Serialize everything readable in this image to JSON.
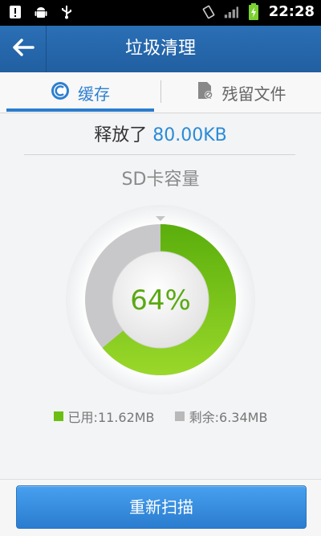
{
  "status_bar": {
    "time": "22:28",
    "icons": [
      "alert-icon",
      "android-icon",
      "usb-icon",
      "vibrate-icon",
      "signal-icon",
      "battery-charging-icon"
    ]
  },
  "header": {
    "title": "垃圾清理"
  },
  "tabs": [
    {
      "label": "缓存",
      "icon": "cache-icon",
      "active": true
    },
    {
      "label": "残留文件",
      "icon": "residual-file-icon",
      "active": false
    }
  ],
  "summary": {
    "prefix": "释放了 ",
    "value": "80.00KB"
  },
  "storage": {
    "label": "SD卡容量",
    "percent_text": "64%",
    "used_fraction": 0.64,
    "used_label": "已用:11.62MB",
    "free_label": "剩余:6.34MB",
    "used_color": "#6bbf12",
    "free_color": "#b9b9b9"
  },
  "actions": {
    "rescan_label": "重新扫描"
  }
}
